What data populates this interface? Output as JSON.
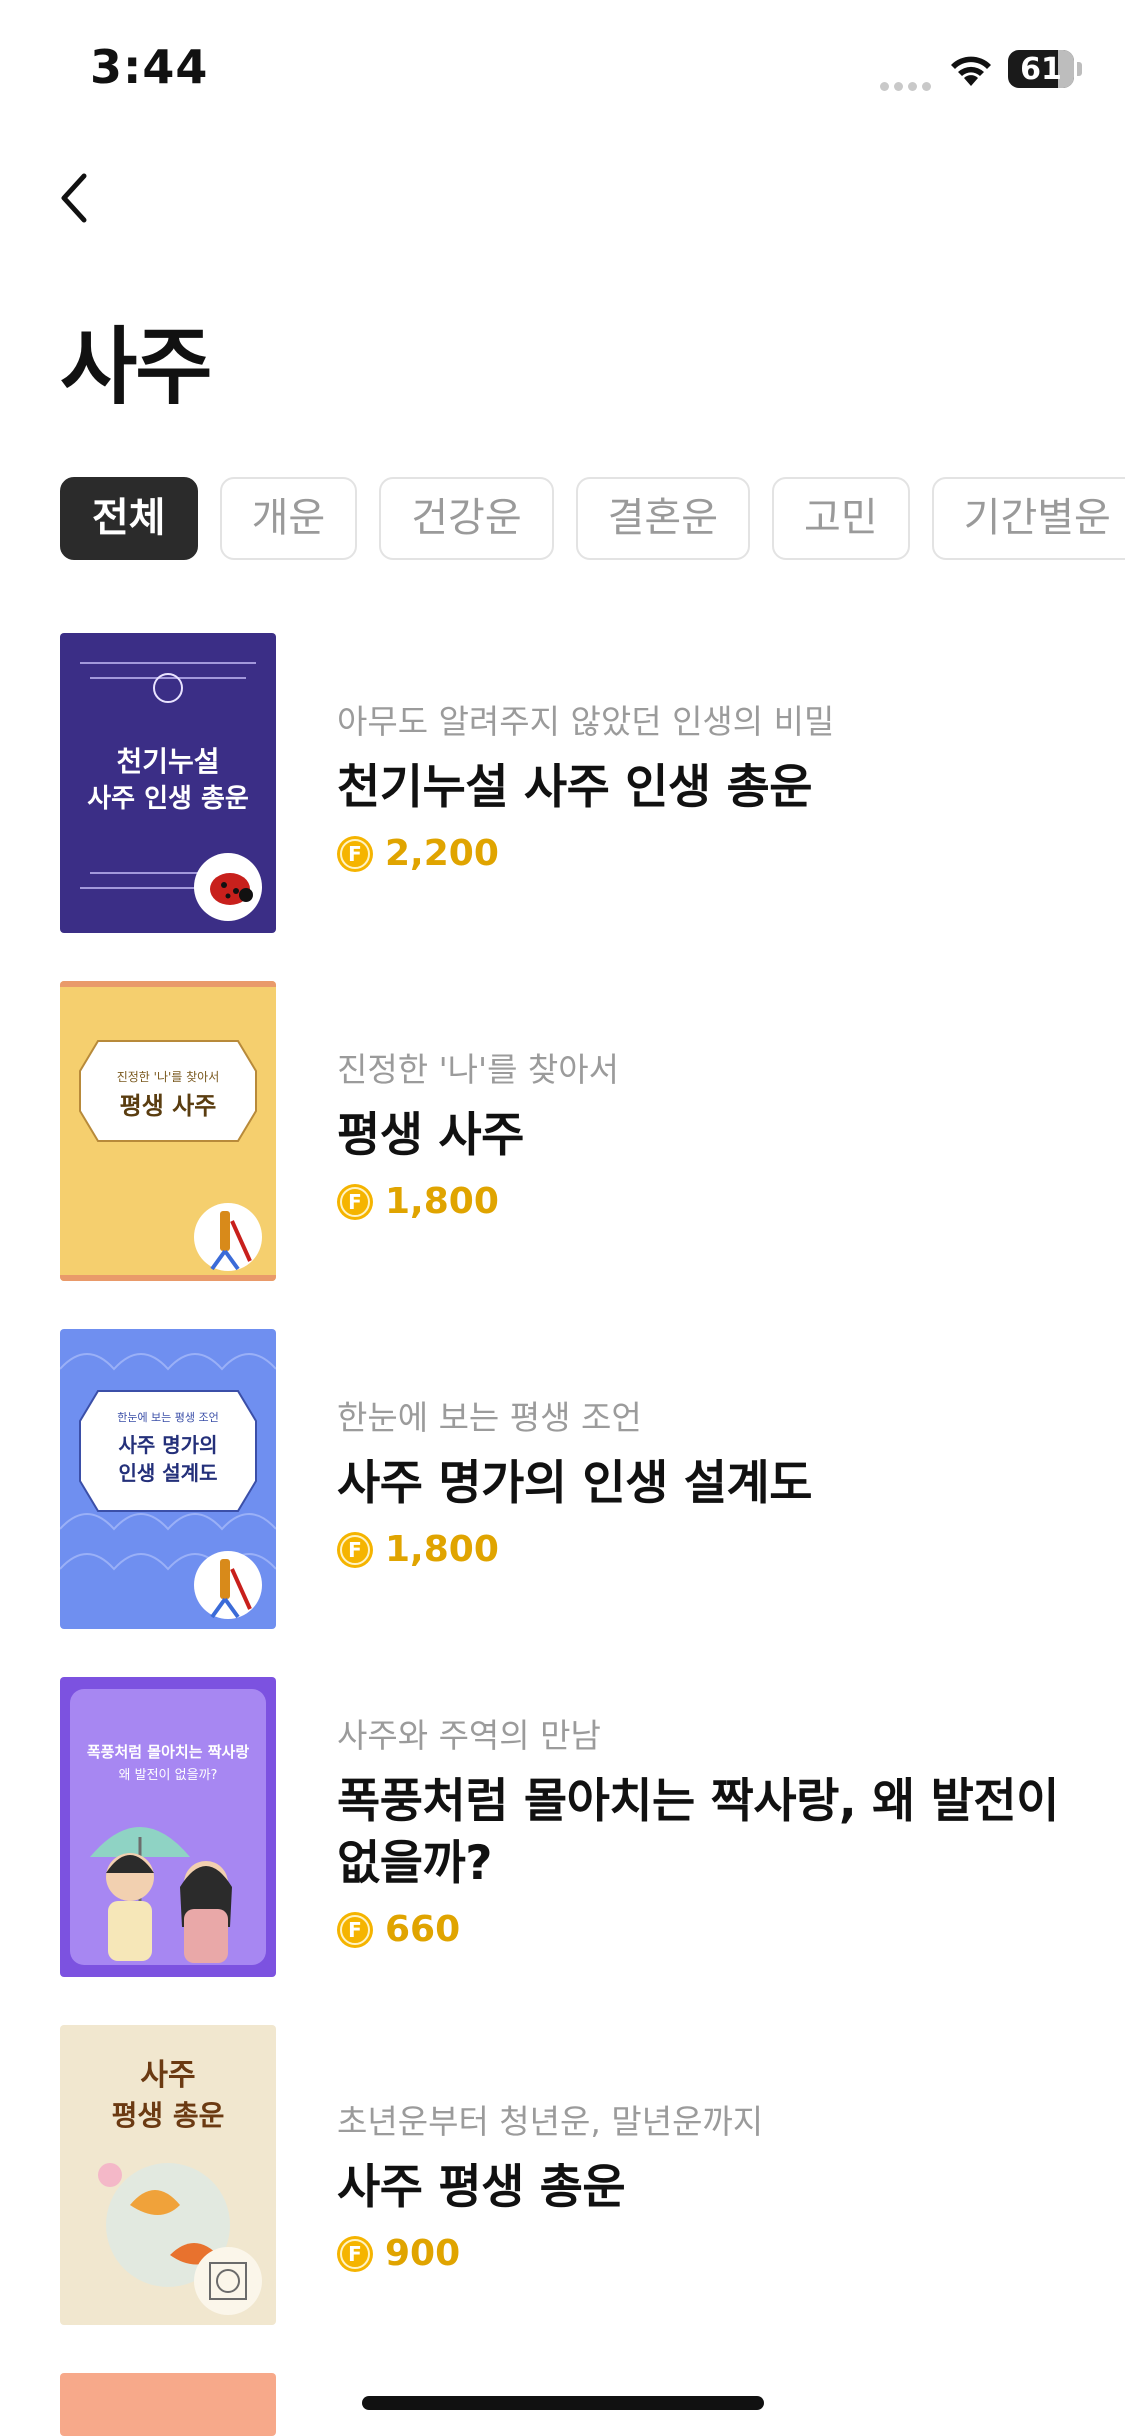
{
  "status": {
    "time": "3:44",
    "battery": "61"
  },
  "page": {
    "title": "사주"
  },
  "categories": [
    {
      "label": "전체",
      "active": true
    },
    {
      "label": "개운"
    },
    {
      "label": "건강운"
    },
    {
      "label": "결혼운"
    },
    {
      "label": "고민"
    },
    {
      "label": "기간별운"
    }
  ],
  "items": [
    {
      "subtitle": "아무도 알려주지 않았던 인생의 비밀",
      "name": "천기누설 사주 인생 총운",
      "price": "2,200",
      "thumb_text": [
        "천기누설",
        "사주 인생 총운"
      ],
      "thumb_bg": "#3b2e86",
      "badge_icon": "ladybug-icon"
    },
    {
      "subtitle": "진정한 '나'를 찾아서",
      "name": "평생 사주",
      "price": "1,800",
      "thumb_text": [
        "진정한 '나'를 찾아서",
        "평생 사주"
      ],
      "thumb_bg": "#f5cf6e",
      "badge_icon": "tassel-icon"
    },
    {
      "subtitle": "한눈에 보는 평생 조언",
      "name": "사주 명가의 인생 설계도",
      "price": "1,800",
      "thumb_text": [
        "한눈에 보는 평생 조언",
        "사주 명가의",
        "인생 설계도"
      ],
      "thumb_bg": "#6f8ff0",
      "badge_icon": "tassel-icon"
    },
    {
      "subtitle": "사주와 주역의 만남",
      "name": "폭풍처럼 몰아치는 짝사랑, 왜 발전이 없을까?",
      "price": "660",
      "thumb_text": [
        "폭풍처럼 몰아치는 짝사랑",
        "왜 발전이 없을까?"
      ],
      "thumb_bg": "#7c52e0",
      "badge_icon": "couple-icon"
    },
    {
      "subtitle": "초년운부터 청년운, 말년운까지",
      "name": "사주 평생 총운",
      "price": "900",
      "thumb_text": [
        "사주",
        "평생 총운"
      ],
      "thumb_bg": "#f1e7cf",
      "badge_icon": "seal-icon"
    }
  ],
  "colors": {
    "accent_price": "#e0a400",
    "coin": "#f5b400",
    "chip_active_bg": "#2b2b2b"
  }
}
